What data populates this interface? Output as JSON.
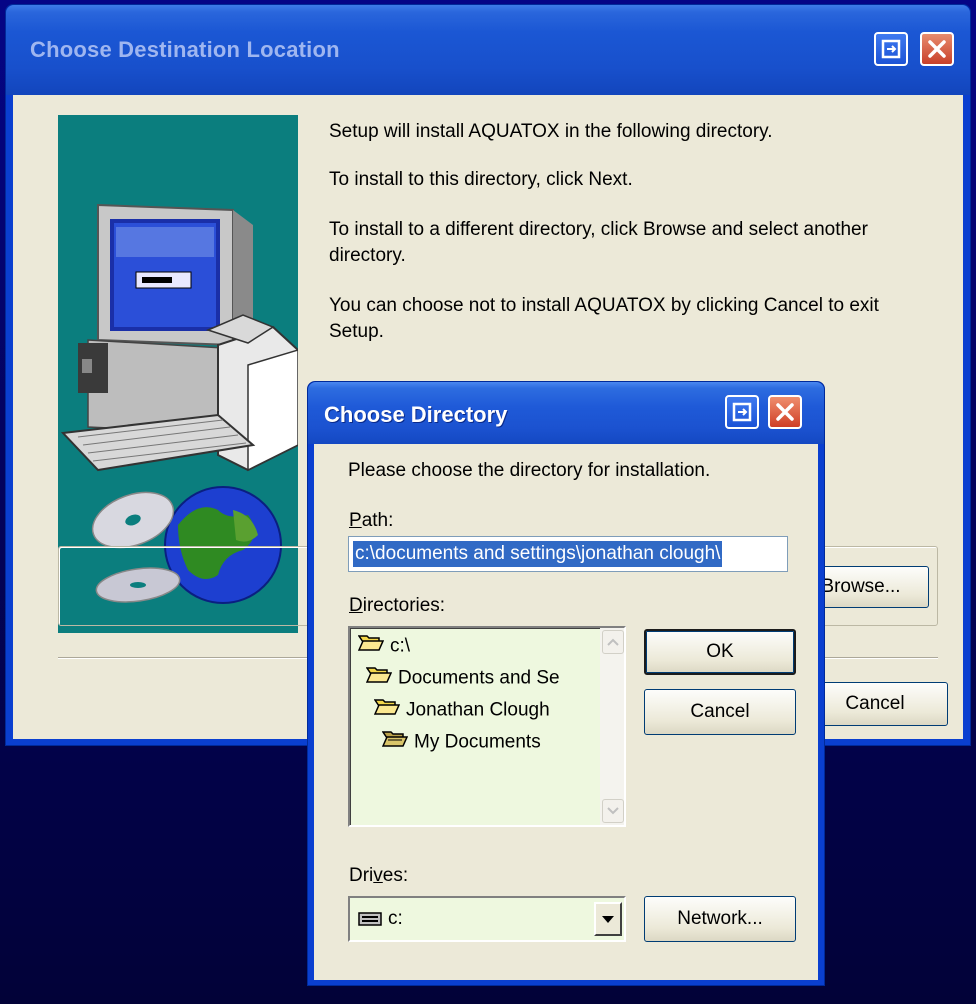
{
  "main_window": {
    "title": "Choose Destination Location",
    "text_1": "Setup will install AQUATOX in the following directory.",
    "text_2": "To install to this directory, click Next.",
    "text_3": "To install to a different directory, click Browse and select another directory.",
    "text_4": "You can choose not to install AQUATOX by clicking Cancel to exit Setup.",
    "browse_label": "Browse...",
    "cancel_label": "Cancel"
  },
  "dialog": {
    "title": "Choose Directory",
    "instruction": "Please choose the directory for installation.",
    "path_label_underlined": "P",
    "path_label_rest": "ath:",
    "path_value": "c:\\documents and settings\\jonathan clough\\",
    "directories_label_underlined": "D",
    "directories_label_rest": "irectories:",
    "directories": [
      {
        "label": "c:\\"
      },
      {
        "label": "Documents and Se"
      },
      {
        "label": "Jonathan Clough"
      },
      {
        "label": "My Documents"
      }
    ],
    "drives_label_pre": "Dri",
    "drives_label_underlined": "v",
    "drives_label_post": "es:",
    "drive_value": "c:",
    "ok_label": "OK",
    "cancel_label": "Cancel",
    "network_label": "Network..."
  },
  "icons": {
    "help": "context-help-icon",
    "close": "close-icon",
    "folder": "folder-open-icon",
    "drive": "hard-drive-icon"
  },
  "colors": {
    "title_bar": "#1b57d4",
    "dialog_face": "#ece9d8",
    "art_background": "#0b7e7e",
    "selection": "#316ac5",
    "list_background": "#eef8df"
  }
}
